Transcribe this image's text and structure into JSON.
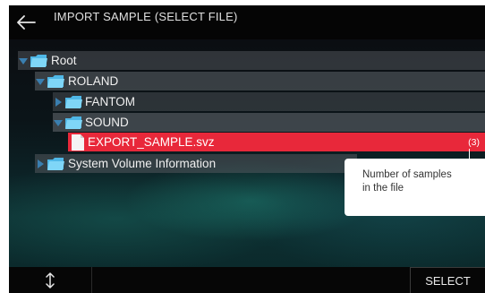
{
  "header": {
    "title": "IMPORT SAMPLE (SELECT FILE)",
    "back_icon": "left-arrow-icon"
  },
  "tree": {
    "items": [
      {
        "label": "Root",
        "expanded": true,
        "level": 0
      },
      {
        "label": "ROLAND",
        "expanded": true,
        "level": 1
      },
      {
        "label": "FANTOM",
        "expanded": false,
        "level": 2
      },
      {
        "label": "SOUND",
        "expanded": true,
        "level": 2
      },
      {
        "label": "EXPORT_SAMPLE.svz",
        "count": "(3)",
        "selected": true,
        "level": 3
      },
      {
        "label": "System Volume Information",
        "expanded": false,
        "level": 1
      }
    ]
  },
  "callout": {
    "text_line1": "Number of samples",
    "text_line2": "in the file"
  },
  "footer": {
    "sort_icon": "up-down-arrow-icon",
    "select_label": "SELECT"
  },
  "colors": {
    "selection": "#e8283a",
    "folder": "#5bc8f2",
    "arrow": "#3a7fb0"
  }
}
